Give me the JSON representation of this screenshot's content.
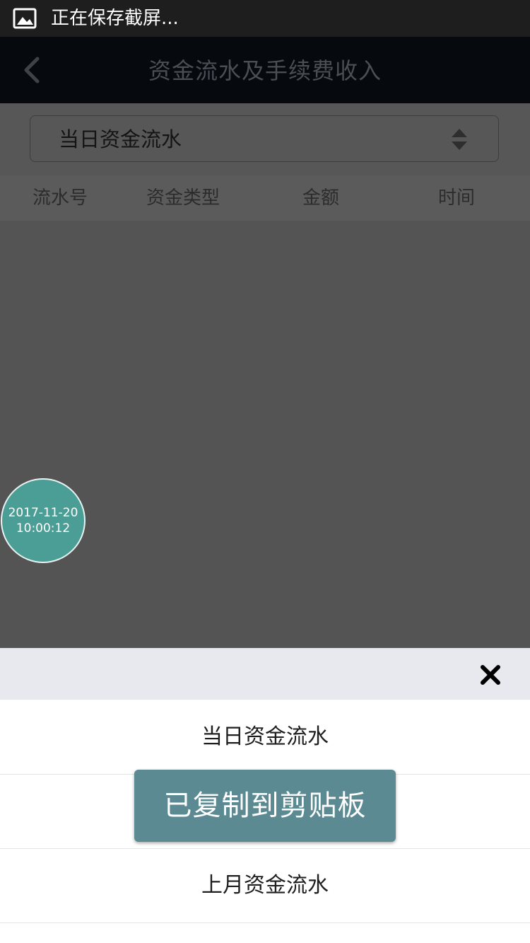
{
  "status_bar": {
    "notification_text": "正在保存截屏...",
    "icon": "image-icon"
  },
  "header": {
    "title": "资金流水及手续费收入",
    "back_icon": "chevron-left-icon"
  },
  "filter": {
    "selected": "当日资金流水",
    "icon": "sort-arrows-icon"
  },
  "table": {
    "columns": [
      "流水号",
      "资金类型",
      "金额",
      "时间"
    ],
    "rows": []
  },
  "floating_clock": {
    "date": "2017-11-20",
    "time": "10:00:12"
  },
  "sheet": {
    "close_icon": "close-icon",
    "options": [
      "当日资金流水",
      "",
      "上月资金流水"
    ]
  },
  "toast": {
    "message": "已复制到剪贴板"
  },
  "colors": {
    "overlay": "#555555",
    "header_bg": "#06090d",
    "bubble": "#4b9e96",
    "toast": "#5b8a92",
    "sheet_header": "#e8e8ef"
  }
}
